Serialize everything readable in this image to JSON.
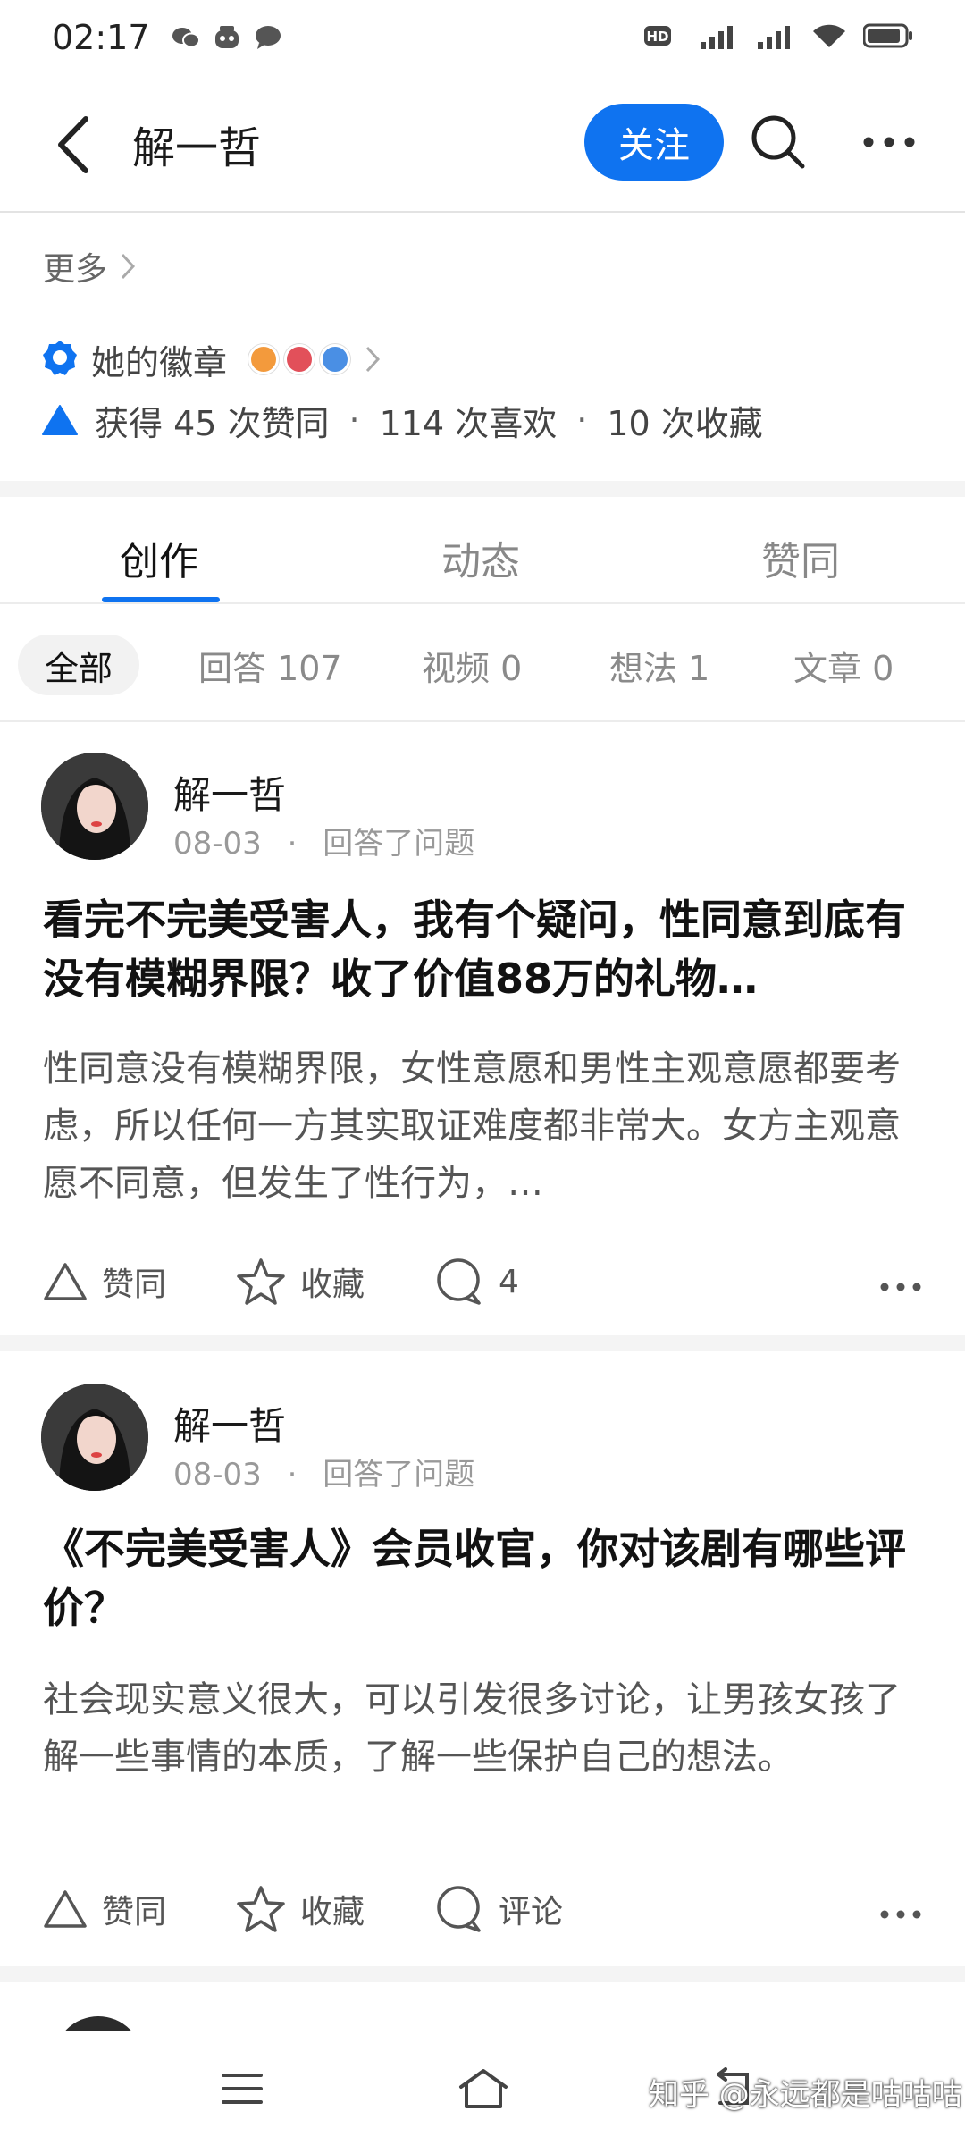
{
  "status_bar": {
    "time": "02:17"
  },
  "header": {
    "title": "解一哲",
    "follow_label": "关注"
  },
  "profile": {
    "more_label": "更多",
    "badges_label": "她的徽章",
    "stats": {
      "likes": "获得 45 次赞同",
      "loves": "114 次喜欢",
      "favorites": "10 次收藏",
      "separator": "·"
    }
  },
  "tabs": [
    {
      "label": "创作"
    },
    {
      "label": "动态"
    },
    {
      "label": "赞同"
    }
  ],
  "filters": [
    {
      "label": "全部"
    },
    {
      "label": "回答 107"
    },
    {
      "label": "视频 0"
    },
    {
      "label": "想法 1"
    },
    {
      "label": "文章 0"
    }
  ],
  "posts": [
    {
      "author": "解一哲",
      "date": "08-03",
      "meta_sep": "·",
      "action": "回答了问题",
      "title": "看完不完美受害人，我有个疑问，性同意到底有没有模糊界限？收了价值88万的礼物…",
      "excerpt": "性同意没有模糊界限，女性意愿和男性主观意愿都要考虑，所以任何一方其实取证难度都非常大。女方主观意愿不同意，但发生了性行为，…",
      "like_label": "赞同",
      "fav_label": "收藏",
      "comment_label": "4"
    },
    {
      "author": "解一哲",
      "date": "08-03",
      "meta_sep": "·",
      "action": "回答了问题",
      "title": "《不完美受害人》会员收官，你对该剧有哪些评价？",
      "excerpt": "社会现实意义很大，可以引发很多讨论，让男孩女孩了解一些事情的本质，了解一些保护自己的想法。",
      "like_label": "赞同",
      "fav_label": "收藏",
      "comment_label": "评论"
    }
  ],
  "watermark": "知乎 @永远都是咕咕咕",
  "colors": {
    "accent": "#0f73f0",
    "text_primary": "#121212",
    "text_secondary": "#999999"
  }
}
